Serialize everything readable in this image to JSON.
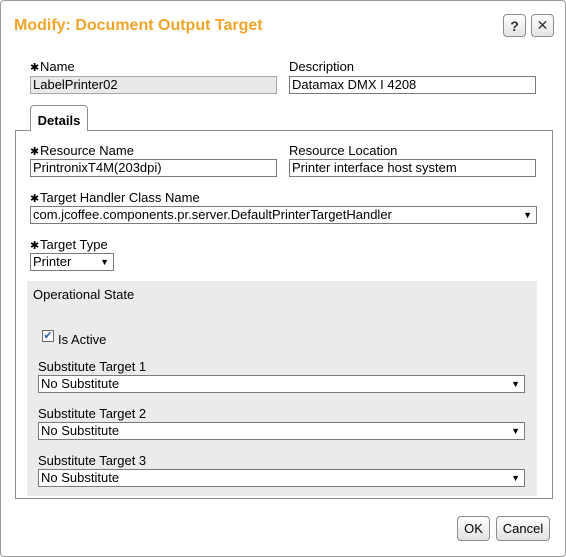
{
  "dialog": {
    "title": "Modify: Document Output Target",
    "help_label": "?",
    "close_label": "✕"
  },
  "form": {
    "required_marker": "✱",
    "name": {
      "label": "Name",
      "value": "LabelPrinter02"
    },
    "description": {
      "label": "Description",
      "value": "Datamax DMX I 4208"
    }
  },
  "tabs": [
    {
      "label": "Details"
    }
  ],
  "details": {
    "resource_name": {
      "label": "Resource Name",
      "value": "PrintronixT4M(203dpi)"
    },
    "resource_location": {
      "label": "Resource Location",
      "value": "Printer interface host system"
    },
    "handler_class": {
      "label": "Target Handler Class Name",
      "value": "com.jcoffee.components.pr.server.DefaultPrinterTargetHandler"
    },
    "target_type": {
      "label": "Target Type",
      "value": "Printer"
    }
  },
  "operational_state": {
    "heading": "Operational State",
    "is_active": {
      "label": "Is Active",
      "checked": true,
      "check_glyph": "✔"
    },
    "substitutes": [
      {
        "label": "Substitute Target 1",
        "value": "No Substitute"
      },
      {
        "label": "Substitute Target 2",
        "value": "No Substitute"
      },
      {
        "label": "Substitute Target 3",
        "value": "No Substitute"
      }
    ]
  },
  "footer": {
    "ok_label": "OK",
    "cancel_label": "Cancel"
  },
  "icons": {
    "dropdown": "chevron-down-icon",
    "help": "help-icon",
    "close": "close-icon",
    "required": "required-asterisk-icon",
    "check": "checkmark-icon"
  },
  "colors": {
    "title": "#f0a42a",
    "panel_bg": "#ebebeb",
    "readonly_bg": "#e9e9e9"
  }
}
